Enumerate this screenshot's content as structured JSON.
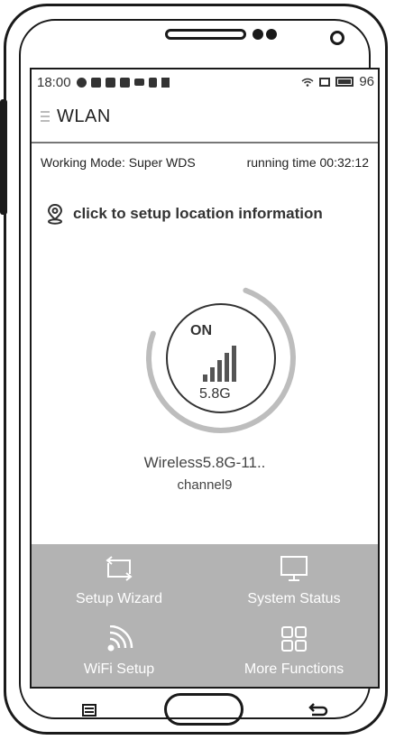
{
  "statusbar": {
    "time": "18:00",
    "battery": "96",
    "icons": [
      "chat-icon",
      "shield-icon",
      "image-icon",
      "mail-icon",
      "folder-icon",
      "doc-icon",
      "usb-icon",
      "wifi-icon",
      "sim-icon",
      "battery-icon"
    ]
  },
  "appbar": {
    "title": "WLAN",
    "menu_icon": "hamburger-icon"
  },
  "info": {
    "working_mode": "Working Mode: Super WDS",
    "running_time": "running time 00:32:12"
  },
  "location": {
    "label": "click to setup location information",
    "icon": "location-pin-icon"
  },
  "gauge": {
    "state": "ON",
    "band": "5.8G",
    "signal_bars_filled": 5,
    "signal_bars_total": 5,
    "arc_fill_fraction": 0.75
  },
  "network": {
    "ssid": "Wireless5.8G-11..",
    "channel": "channel9"
  },
  "actions": [
    {
      "label": "Setup Wizard",
      "icon": "repeat-icon"
    },
    {
      "label": "System Status",
      "icon": "monitor-icon"
    },
    {
      "label": "WiFi Setup",
      "icon": "wifi-icon"
    },
    {
      "label": "More Functions",
      "icon": "grid-icon"
    }
  ],
  "colors": {
    "panel_bg": "#b3b3b3",
    "text_primary": "#222222",
    "arc_color": "#bdbdbd"
  }
}
